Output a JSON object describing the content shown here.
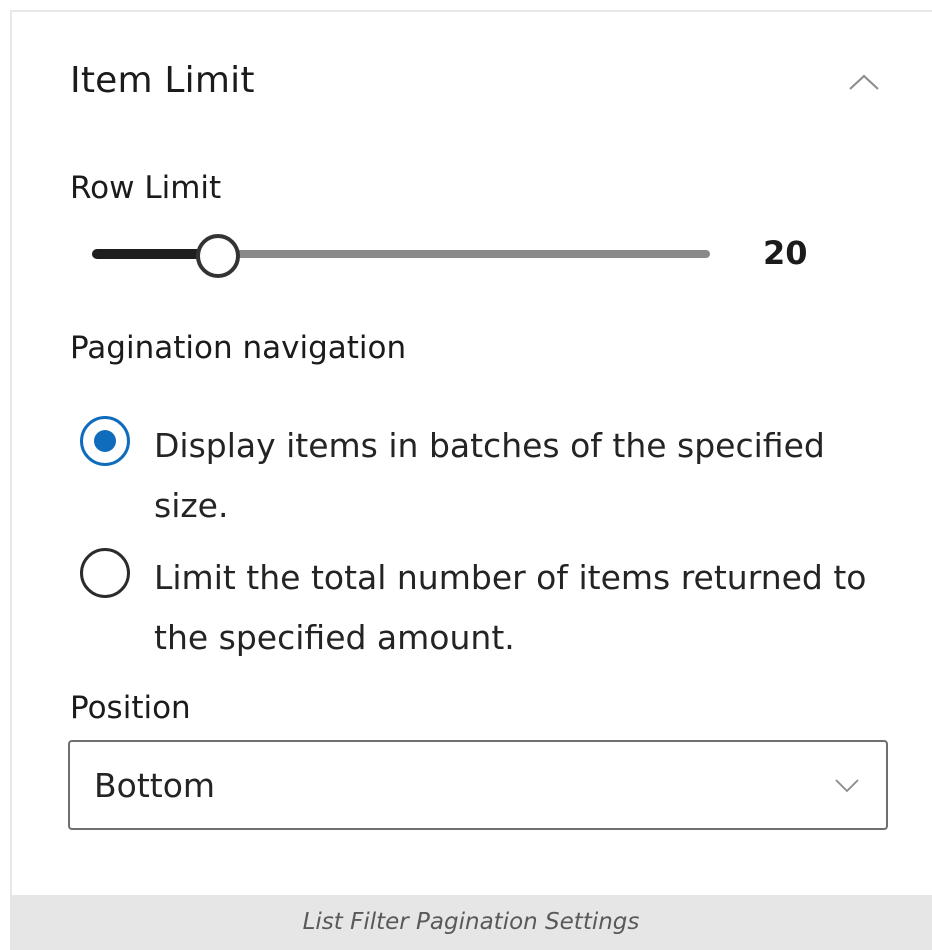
{
  "panel": {
    "title": "Item Limit",
    "collapse_icon": "chevron-up-icon"
  },
  "row_limit": {
    "label": "Row Limit",
    "value": "20",
    "slider_fraction": 0.2,
    "fill_color": "#1f1f1f",
    "track_color": "#8a8a8a"
  },
  "pagination": {
    "label": "Pagination navigation",
    "accent_color": "#0f6cbd",
    "options": [
      {
        "label": "Display items in batches of the specified size.",
        "checked": true
      },
      {
        "label": "Limit the total number of items returned to the specified amount.",
        "checked": false
      }
    ]
  },
  "position": {
    "label": "Position",
    "selected": "Bottom",
    "icon": "chevron-down-icon"
  },
  "caption": "List Filter Pagination Settings"
}
